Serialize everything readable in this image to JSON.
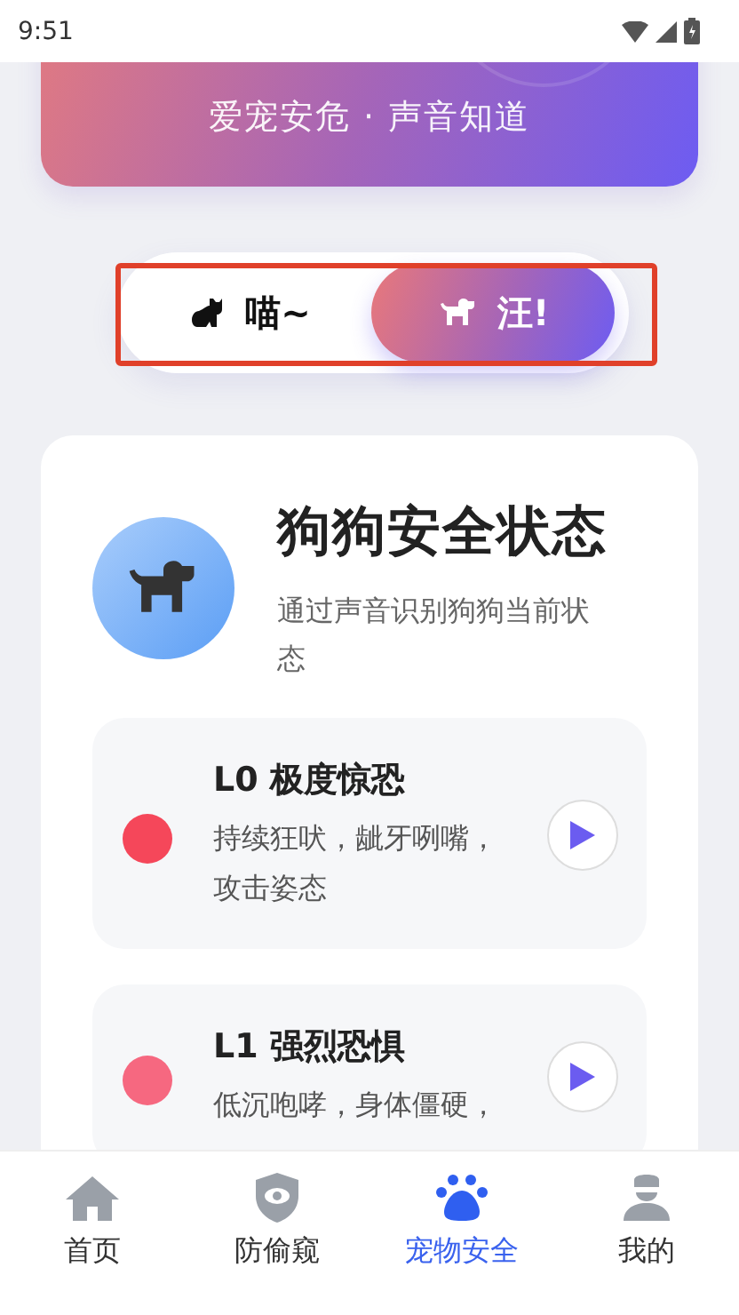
{
  "status_bar": {
    "time": "9:51"
  },
  "banner": {
    "slogan": "爱宠安危 · 声音知道"
  },
  "pet_switch": [
    {
      "label": "喵~",
      "kind": "cat",
      "selected": false
    },
    {
      "label": "汪!",
      "kind": "dog",
      "selected": true
    }
  ],
  "status_card": {
    "title": "狗狗安全状态",
    "subtitle": "通过声音识别狗狗当前状态",
    "levels": [
      {
        "title": "L0 极度惊恐",
        "description": "持续狂吠，龇牙咧嘴，攻击姿态",
        "color": "#f5475a"
      },
      {
        "title": "L1 强烈恐惧",
        "description": "低沉咆哮，身体僵硬，",
        "color": "#f66880"
      }
    ]
  },
  "tab_bar": [
    {
      "label": "首页",
      "kind": "home",
      "selected": false
    },
    {
      "label": "防偷窥",
      "kind": "shield",
      "selected": false
    },
    {
      "label": "宠物安全",
      "kind": "paw",
      "selected": true
    },
    {
      "label": "我的",
      "kind": "person",
      "selected": false
    }
  ]
}
